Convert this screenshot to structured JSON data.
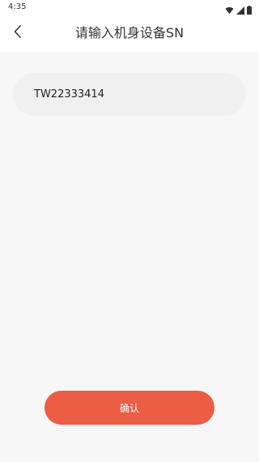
{
  "status_bar": {
    "time": "4:35",
    "wifi_icon": "wifi-icon",
    "signal_icon": "signal-icon",
    "battery_icon": "battery-icon"
  },
  "header": {
    "back_icon": "chevron-left-icon",
    "title": "请输入机身设备SN"
  },
  "form": {
    "sn_value": "TW22333414"
  },
  "actions": {
    "confirm_label": "确认"
  },
  "colors": {
    "accent": "#ec5d45",
    "page_background": "#f7f7f7",
    "input_background": "#f0f0f0",
    "header_background": "#ffffff"
  }
}
